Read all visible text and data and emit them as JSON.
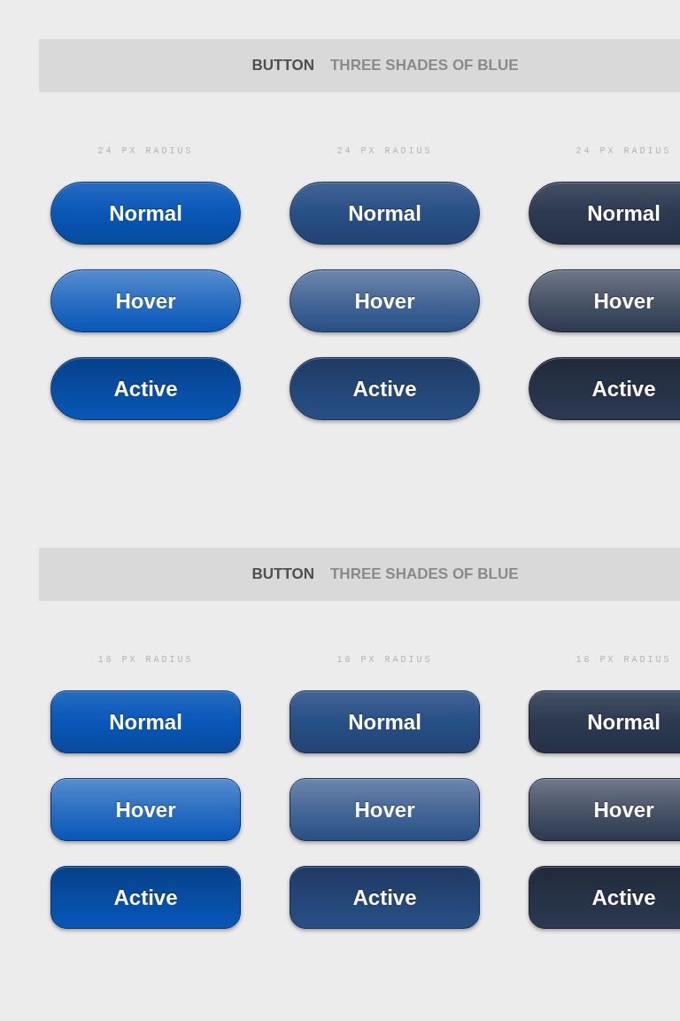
{
  "sections": [
    {
      "kind": "pill",
      "heading": {
        "bold": "BUTTON",
        "text": "THREE SHADES OF BLUE"
      },
      "columns": [
        {
          "label": "24 PX RADIUS",
          "color": "#0857b8",
          "buttons": [
            {
              "label": "Normal",
              "kind": "normal"
            },
            {
              "label": "Hover",
              "kind": "hover"
            },
            {
              "label": "Active",
              "kind": "active"
            }
          ]
        },
        {
          "label": "24 PX RADIUS",
          "color": "#284f86",
          "buttons": [
            {
              "label": "Normal",
              "kind": "normal"
            },
            {
              "label": "Hover",
              "kind": "hover"
            },
            {
              "label": "Active",
              "kind": "active"
            }
          ]
        },
        {
          "label": "24 PX RADIUS",
          "color": "#2c3951",
          "buttons": [
            {
              "label": "Normal",
              "kind": "normal"
            },
            {
              "label": "Hover",
              "kind": "hover"
            },
            {
              "label": "Active",
              "kind": "active"
            }
          ]
        }
      ]
    },
    {
      "kind": "rounded",
      "heading": {
        "bold": "BUTTON",
        "text": "THREE SHADES OF BLUE"
      },
      "columns": [
        {
          "label": "18 PX RADIUS",
          "color": "#0857b8",
          "buttons": [
            {
              "label": "Normal",
              "kind": "normal"
            },
            {
              "label": "Hover",
              "kind": "hover"
            },
            {
              "label": "Active",
              "kind": "active"
            }
          ]
        },
        {
          "label": "18 PX RADIUS",
          "color": "#284f86",
          "buttons": [
            {
              "label": "Normal",
              "kind": "normal"
            },
            {
              "label": "Hover",
              "kind": "hover"
            },
            {
              "label": "Active",
              "kind": "active"
            }
          ]
        },
        {
          "label": "18 PX RADIUS",
          "color": "#2c3951",
          "buttons": [
            {
              "label": "Normal",
              "kind": "normal"
            },
            {
              "label": "Hover",
              "kind": "hover"
            },
            {
              "label": "Active",
              "kind": "active"
            }
          ]
        }
      ]
    }
  ]
}
